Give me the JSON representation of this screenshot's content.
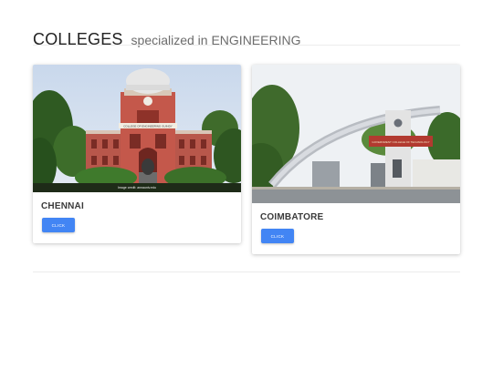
{
  "header": {
    "title_main": "COLLEGES",
    "title_sub": "specialized in ENGINEERING"
  },
  "cards": [
    {
      "city": "CHENNAI",
      "button_label": "CLICK",
      "image_sign": "COLLEGE OF ENGINEERING GUINDY",
      "image_credit": "Image credit: annauniv.edu"
    },
    {
      "city": "COIMBATORE",
      "button_label": "CLICK",
      "image_sign": "GOVERNMENT COLLEGE OF TECHNOLOGY"
    }
  ],
  "colors": {
    "button": "#4285f4",
    "title": "#222222",
    "subtitle": "#6c6c6c"
  }
}
